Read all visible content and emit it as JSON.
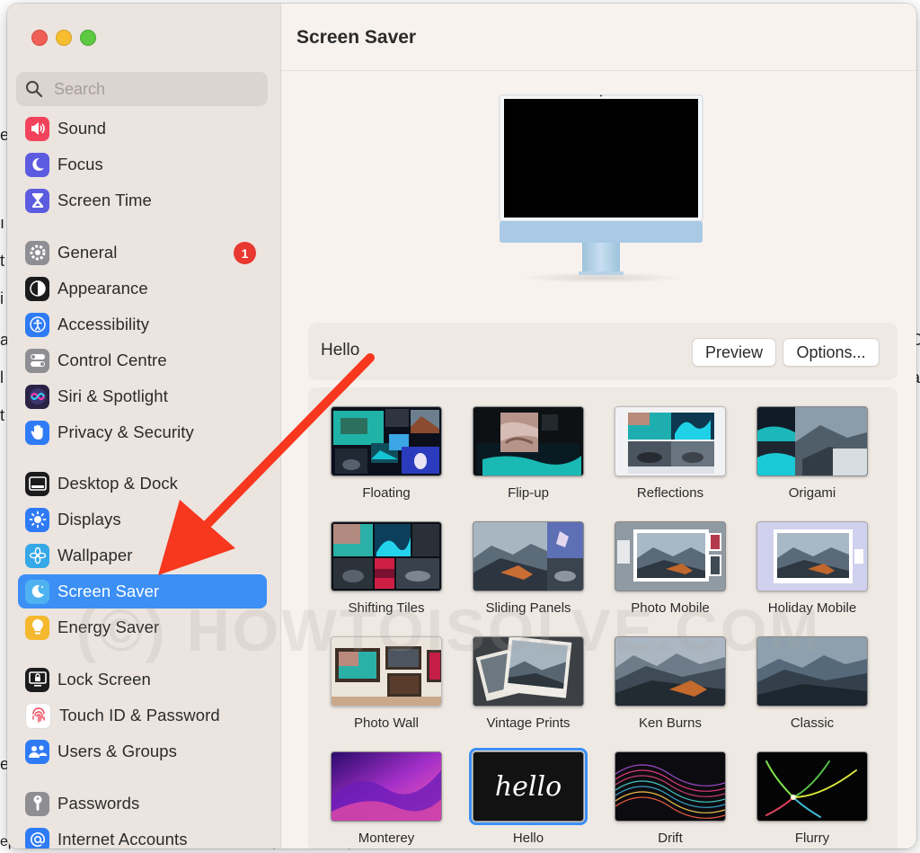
{
  "window": {
    "title": "Screen Saver"
  },
  "search": {
    "placeholder": "Search"
  },
  "sidebar": {
    "items": [
      {
        "label": "Sound",
        "icon": "speaker-icon",
        "color": "#f2435b"
      },
      {
        "label": "Focus",
        "icon": "moon-icon",
        "color": "#5c5ce0"
      },
      {
        "label": "Screen Time",
        "icon": "hourglass-icon",
        "color": "#5c5ce0"
      },
      {
        "label": "General",
        "icon": "gear-icon",
        "color": "#8e8e93",
        "badge": "1"
      },
      {
        "label": "Appearance",
        "icon": "appearance-icon",
        "color": "#1c1c1e"
      },
      {
        "label": "Accessibility",
        "icon": "accessibility-icon",
        "color": "#2f7bf5"
      },
      {
        "label": "Control Centre",
        "icon": "toggles-icon",
        "color": "#8e8e93"
      },
      {
        "label": "Siri & Spotlight",
        "icon": "siri-icon",
        "color": "#3a2e6e"
      },
      {
        "label": "Privacy & Security",
        "icon": "hand-icon",
        "color": "#2f7bf5"
      },
      {
        "label": "Desktop & Dock",
        "icon": "dock-icon",
        "color": "#1c1c1e"
      },
      {
        "label": "Displays",
        "icon": "sun-icon",
        "color": "#2f7bf5"
      },
      {
        "label": "Wallpaper",
        "icon": "flower-icon",
        "color": "#35a8e8"
      },
      {
        "label": "Screen Saver",
        "icon": "screensaver-icon",
        "color": "#4fb2f0",
        "selected": true
      },
      {
        "label": "Energy Saver",
        "icon": "bulb-icon",
        "color": "#f5b82e"
      },
      {
        "label": "Lock Screen",
        "icon": "lock-screen-icon",
        "color": "#1c1c1e"
      },
      {
        "label": "Touch ID & Password",
        "icon": "fingerprint-icon",
        "color": "#ffffff"
      },
      {
        "label": "Users & Groups",
        "icon": "users-icon",
        "color": "#2f7bf5"
      },
      {
        "label": "Passwords",
        "icon": "key-icon",
        "color": "#8e8e93"
      },
      {
        "label": "Internet Accounts",
        "icon": "at-icon",
        "color": "#2f7bf5"
      }
    ]
  },
  "current_saver": {
    "name": "Hello",
    "preview_label": "Preview",
    "options_label": "Options..."
  },
  "savers": [
    {
      "name": "Floating"
    },
    {
      "name": "Flip-up"
    },
    {
      "name": "Reflections"
    },
    {
      "name": "Origami"
    },
    {
      "name": "Shifting Tiles"
    },
    {
      "name": "Sliding Panels"
    },
    {
      "name": "Photo Mobile"
    },
    {
      "name": "Holiday Mobile"
    },
    {
      "name": "Photo Wall"
    },
    {
      "name": "Vintage Prints"
    },
    {
      "name": "Ken Burns"
    },
    {
      "name": "Classic"
    },
    {
      "name": "Monterey"
    },
    {
      "name": "Hello",
      "selected": true
    },
    {
      "name": "Drift"
    },
    {
      "name": "Flurry"
    }
  ],
  "hello_text": "hello",
  "watermark": "(©) HOWTOISOLVE.COM",
  "accent_color": "#3b8ff5"
}
